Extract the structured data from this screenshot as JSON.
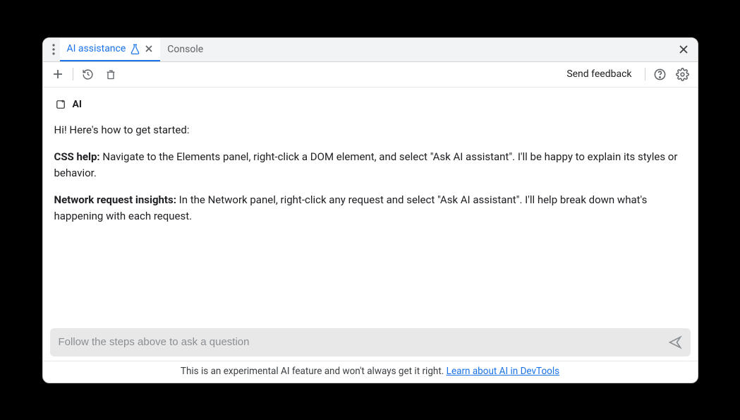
{
  "tabs": {
    "active": {
      "label": "AI assistance"
    },
    "console": {
      "label": "Console"
    }
  },
  "toolbar": {
    "feedback": "Send feedback"
  },
  "chat": {
    "speaker": "AI",
    "greeting": "Hi! Here's how to get started:",
    "css_help_label": "CSS help:",
    "css_help_text": " Navigate to the Elements panel, right-click a DOM element, and select \"Ask AI assistant\". I'll be happy to explain its styles or behavior.",
    "net_label": "Network request insights:",
    "net_text": " In the Network panel, right-click any request and select \"Ask AI assistant\". I'll help break down what's happening with each request."
  },
  "input": {
    "placeholder": "Follow the steps above to ask a question"
  },
  "footer": {
    "text": "This is an experimental AI feature and won't always get it right. ",
    "link": "Learn about AI in DevTools"
  }
}
